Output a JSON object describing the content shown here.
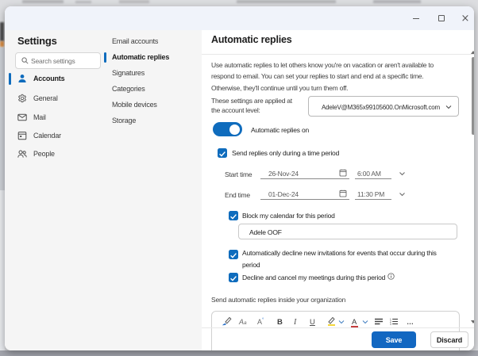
{
  "window": {
    "titlebar_controls": [
      "minimize",
      "maximize",
      "close"
    ]
  },
  "sidebar": {
    "title": "Settings",
    "search_placeholder": "Search settings",
    "items": [
      {
        "label": "Accounts",
        "icon": "person-icon",
        "selected": true
      },
      {
        "label": "General",
        "icon": "gear-icon",
        "selected": false
      },
      {
        "label": "Mail",
        "icon": "mail-icon",
        "selected": false
      },
      {
        "label": "Calendar",
        "icon": "calendar-icon",
        "selected": false
      },
      {
        "label": "People",
        "icon": "people-icon",
        "selected": false
      }
    ]
  },
  "subnav": {
    "items": [
      {
        "label": "Email accounts",
        "selected": false
      },
      {
        "label": "Automatic replies",
        "selected": true
      },
      {
        "label": "Signatures",
        "selected": false
      },
      {
        "label": "Categories",
        "selected": false
      },
      {
        "label": "Mobile devices",
        "selected": false
      },
      {
        "label": "Storage",
        "selected": false
      }
    ]
  },
  "content": {
    "title": "Automatic replies",
    "description": "Use automatic replies to let others know you're on vacation or aren't available to respond to email. You can set your replies to start and end at a specific time. Otherwise, they'll continue until you turn them off.",
    "scope_label_line1": "These settings are applied at",
    "scope_label_line2": "the account level:",
    "account_email": "AdeleV@M365x99105600.OnMicrosoft.com",
    "toggle": {
      "label": "Automatic replies on",
      "state": "on"
    },
    "period_checkbox_label": "Send replies only during a time period",
    "start_row": {
      "label": "Start time",
      "date": "26-Nov-24",
      "time": "6:00 AM"
    },
    "end_row": {
      "label": "End time",
      "date": "01-Dec-24",
      "time": "11:30 PM"
    },
    "block_calendar_label": "Block my calendar for this period",
    "event_title_value": "Adele OOF",
    "auto_decline_label": "Automatically decline new invitations for events that occur during this period",
    "decline_cancel_label": "Decline and cancel my meetings during this period",
    "inside_org_label": "Send automatic replies inside your organization",
    "toolbar": {
      "icons": [
        "format-painter",
        "font",
        "font-size",
        "bold",
        "italic",
        "underline",
        "text-highlight",
        "font-color",
        "bulleted-list",
        "numbered-list",
        "more-options"
      ],
      "bold_glyph": "B",
      "italic_glyph": "I",
      "underline_glyph": "U",
      "font_glyph": "A",
      "font_size_glyph": "A",
      "font_color_glyph": "A",
      "more_glyph": "…",
      "check_glyph": "✓"
    },
    "footer": {
      "save_label": "Save",
      "discard_label": "Discard"
    }
  },
  "colors": {
    "accent": "#0f6cbd",
    "highlight": "#f3d63c",
    "font_color_red": "#c43e3e"
  }
}
